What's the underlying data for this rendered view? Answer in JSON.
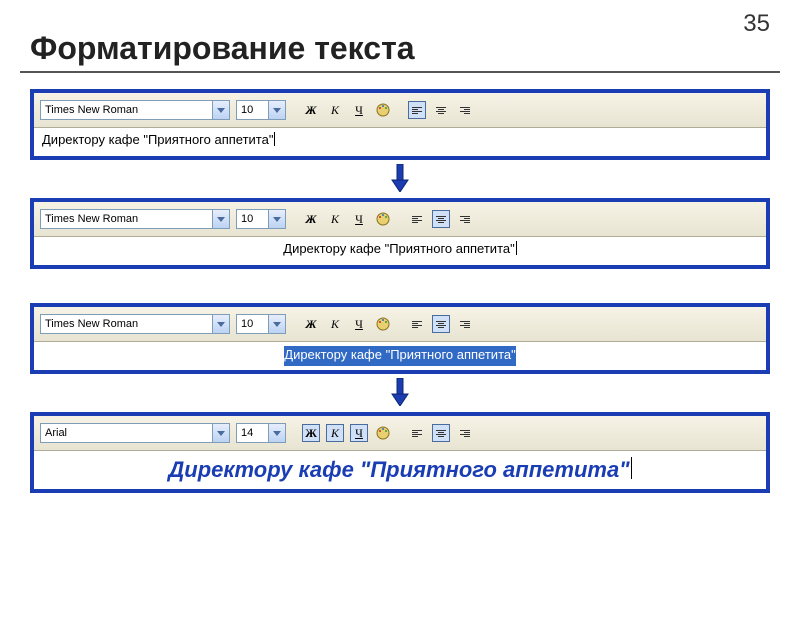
{
  "page_number": "35",
  "title": "Форматирование текста",
  "icons": {
    "bold": "Ж",
    "italic": "К",
    "underline": "Ч"
  },
  "panel1": {
    "font": "Times New Roman",
    "size": "10",
    "text": "Директору кафе \"Приятного аппетита\"",
    "align": "left",
    "active_align": "left"
  },
  "panel2": {
    "font": "Times New Roman",
    "size": "10",
    "text": "Директору кафе \"Приятного аппетита\"",
    "align": "center",
    "active_align": "center"
  },
  "panel3": {
    "font": "Times New Roman",
    "size": "10",
    "text": "Директору кафе \"Приятного аппетита\"",
    "align": "center",
    "active_align": "center",
    "selected": true
  },
  "panel4": {
    "font": "Arial",
    "size": "14",
    "text": "Директору кафе \"Приятного аппетита\"",
    "align": "center",
    "active_align": "center",
    "active_fmt": [
      "bold",
      "italic",
      "underline"
    ]
  }
}
